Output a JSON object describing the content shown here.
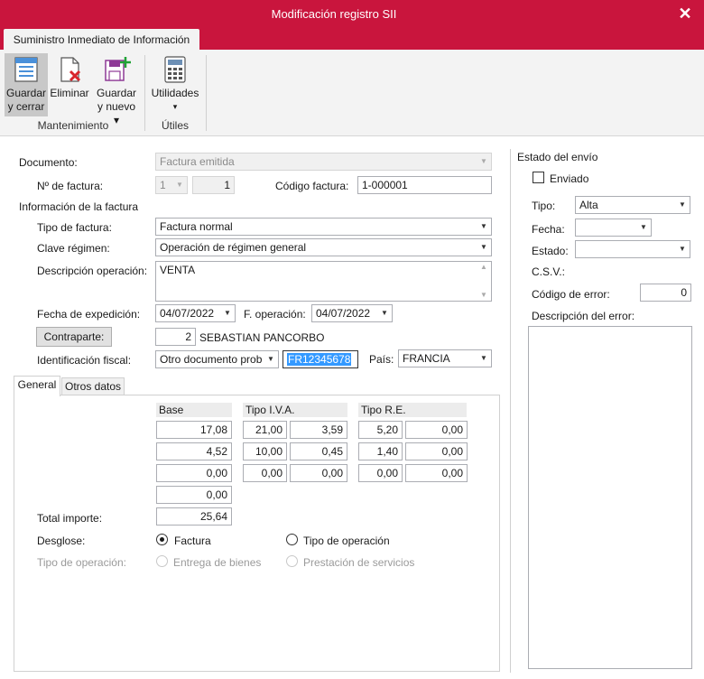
{
  "window": {
    "title": "Modificación registro SII",
    "close_glyph": "✕"
  },
  "ribbon": {
    "tab_label": "Suministro Inmediato de Información",
    "buttons": [
      {
        "line1": "Guardar",
        "line2": "y cerrar",
        "icon": "save-close-icon"
      },
      {
        "line1": "Eliminar",
        "line2": "",
        "icon": "delete-icon"
      },
      {
        "line1": "Guardar",
        "line2": "y nuevo ▾",
        "icon": "save-new-icon"
      },
      {
        "line1": "Utilidades",
        "line2": "▾",
        "icon": "calculator-icon"
      }
    ],
    "groups": [
      "Mantenimiento",
      "Útiles"
    ]
  },
  "form": {
    "documento_label": "Documento:",
    "documento_value": "Factura emitida",
    "nfactura_label": "Nº de factura:",
    "nfactura_serie": "1",
    "nfactura_num": "1",
    "codigo_label": "Código factura:",
    "codigo_value": "1-000001",
    "info_title": "Información de la factura",
    "tipo_label": "Tipo de factura:",
    "tipo_value": "Factura normal",
    "clave_label": "Clave régimen:",
    "clave_value": "Operación de régimen general",
    "desc_label": "Descripción operación:",
    "desc_value": "VENTA",
    "fecha_exp_label": "Fecha de expedición:",
    "fecha_exp_value": "04/07/2022",
    "f_op_label": "F. operación:",
    "f_op_value": "04/07/2022",
    "contraparte_button": "Contraparte:",
    "contraparte_code": "2",
    "contraparte_name": "SEBASTIAN PANCORBO",
    "ident_label": "Identificación fiscal:",
    "ident_type": "Otro documento prob",
    "ident_value": "FR12345678",
    "pais_label": "País:",
    "pais_value": "FRANCIA"
  },
  "tabs": [
    "General",
    "Otros datos"
  ],
  "general": {
    "headers": {
      "base": "Base",
      "iva": "Tipo I.V.A.",
      "re": "Tipo R.E."
    },
    "rows": [
      {
        "base": "17,08",
        "iva_pct": "21,00",
        "iva_amt": "3,59",
        "re_pct": "5,20",
        "re_amt": "0,00"
      },
      {
        "base": "4,52",
        "iva_pct": "10,00",
        "iva_amt": "0,45",
        "re_pct": "1,40",
        "re_amt": "0,00"
      },
      {
        "base": "0,00",
        "iva_pct": "0,00",
        "iva_amt": "0,00",
        "re_pct": "0,00",
        "re_amt": "0,00"
      }
    ],
    "base_extra": "0,00",
    "total_label": "Total importe:",
    "total_value": "25,64",
    "desglose_label": "Desglose:",
    "desglose_opt1": "Factura",
    "desglose_opt2": "Tipo de operación",
    "desglose_selected": "Factura",
    "tipo_op_label": "Tipo de operación:",
    "tipo_op_opt1": "Entrega de bienes",
    "tipo_op_opt2": "Prestación de servicios"
  },
  "estado": {
    "title": "Estado del envío",
    "enviado_label": "Enviado",
    "enviado_checked": false,
    "tipo_label": "Tipo:",
    "tipo_value": "Alta",
    "fecha_label": "Fecha:",
    "fecha_value": "",
    "estado_label": "Estado:",
    "estado_value": "",
    "csv_label": "C.S.V.:",
    "codigo_error_label": "Código de error:",
    "codigo_error_value": "0",
    "desc_error_label": "Descripción del error:"
  },
  "colors": {
    "accent": "#c9153d",
    "selection": "#3399ff"
  }
}
